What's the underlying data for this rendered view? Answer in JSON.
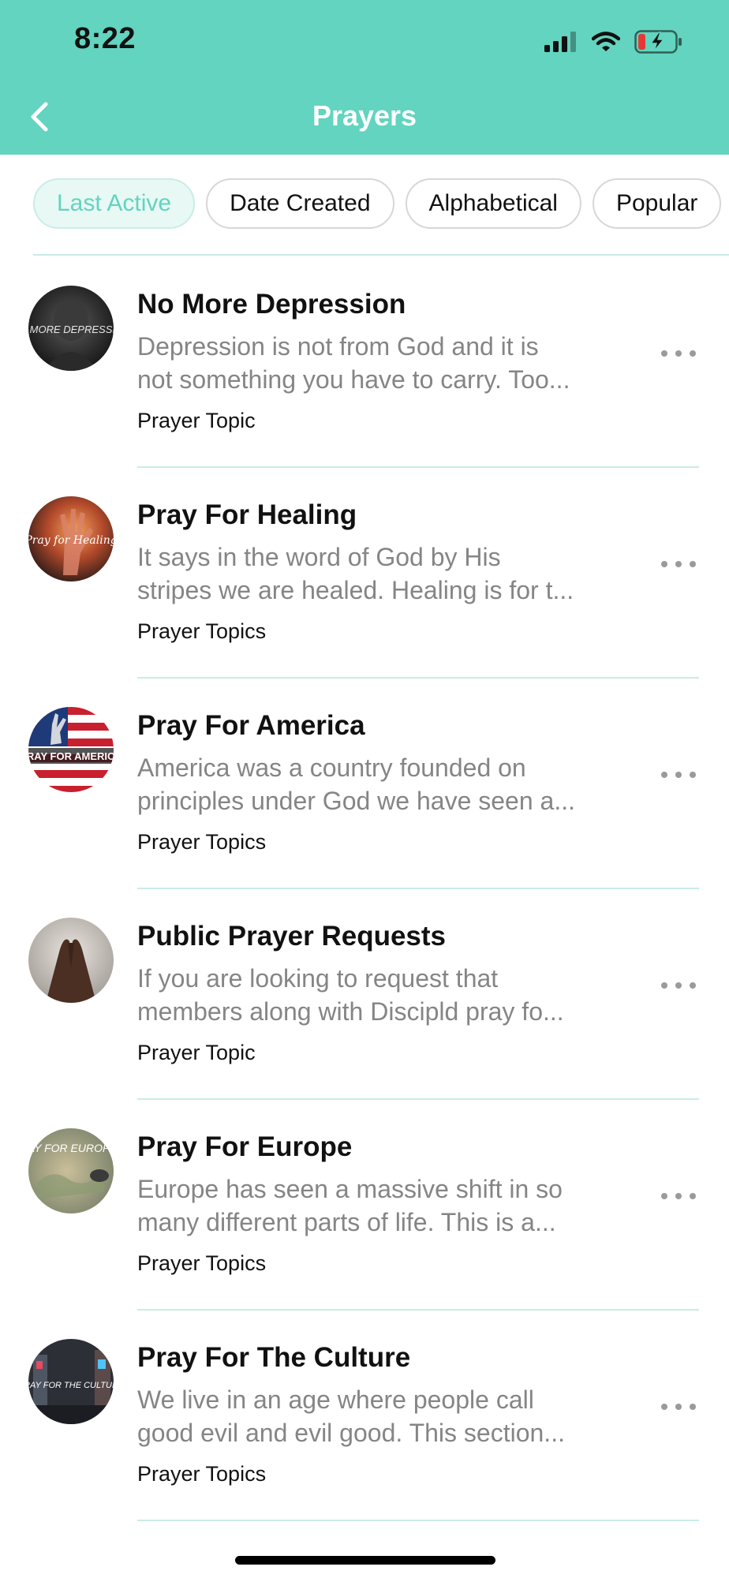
{
  "status_bar": {
    "time": "8:22"
  },
  "header": {
    "title": "Prayers",
    "back_icon": "chevron-left-icon",
    "color": "#62d4bf"
  },
  "filters": {
    "active": "Last Active",
    "items": [
      "Last Active",
      "Date Created",
      "Alphabetical",
      "Popular"
    ]
  },
  "prayers": [
    {
      "title": "No More Depression",
      "desc_line1": "Depression is not from God and it is",
      "desc_line2": "not something you have to carry. Too...",
      "meta": "Prayer Topic",
      "avatar_text": "NO MORE DEPRESSION"
    },
    {
      "title": "Pray For Healing",
      "desc_line1": "It says in the word of God by His",
      "desc_line2": "stripes we are healed. Healing is for t...",
      "meta": "Prayer Topics",
      "avatar_text": "Pray for Healing"
    },
    {
      "title": "Pray For America",
      "desc_line1": "America was a country founded on",
      "desc_line2": "principles under God we have seen a...",
      "meta": "Prayer Topics",
      "avatar_text": "PRAY FOR AMERICA"
    },
    {
      "title": "Public Prayer Requests",
      "desc_line1": "If you are looking to request that",
      "desc_line2": "members along with Discipld pray fo...",
      "meta": "Prayer Topic",
      "avatar_text": ""
    },
    {
      "title": "Pray For Europe",
      "desc_line1": "Europe has seen a massive shift in so",
      "desc_line2": "many different parts of life. This is a...",
      "meta": "Prayer Topics",
      "avatar_text": "PRAY FOR EUROPE"
    },
    {
      "title": "Pray For The Culture",
      "desc_line1": "We live in an age where people call",
      "desc_line2": "good evil and evil good. This section...",
      "meta": "Prayer Topics",
      "avatar_text": "PRAY FOR THE CULTURE"
    }
  ]
}
